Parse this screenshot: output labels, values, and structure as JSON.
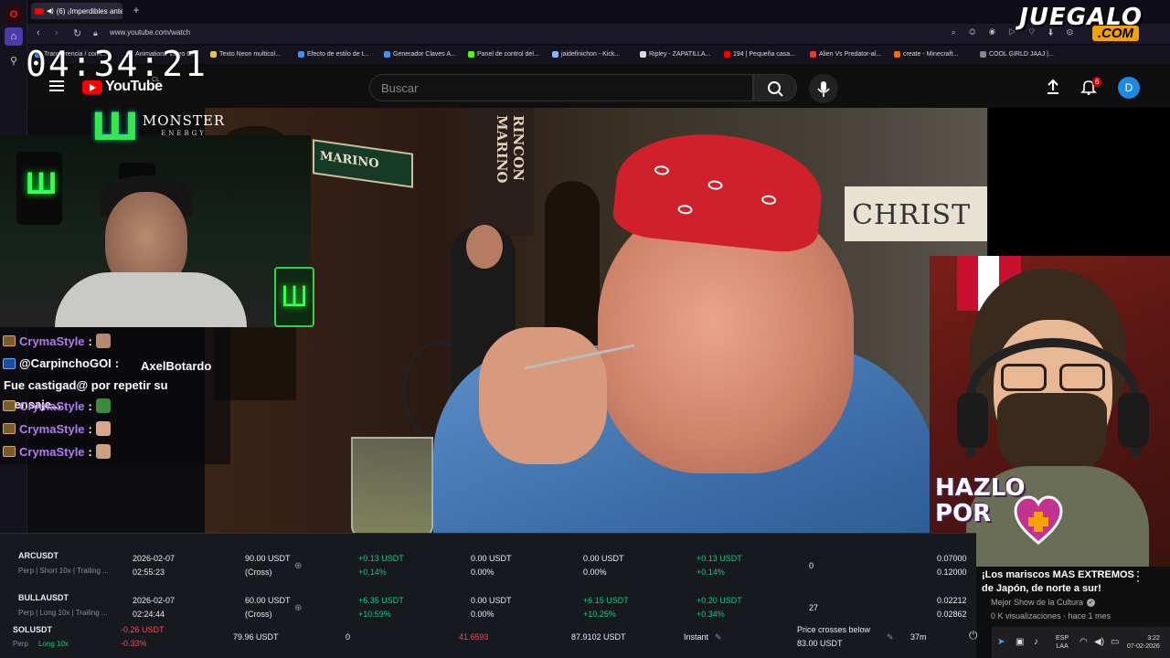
{
  "browser": {
    "tab_title": "(6) ¡Imperdibles ante",
    "url": "www.youtube.com/watch",
    "bookmarks": [
      "Transferencia / comi...",
      "Animations Video C...",
      "Texto Neon multicol...",
      "Efecto de estilo de t...",
      "Generador Claves A...",
      "Panel de control del...",
      "jaidefinichon - Kick...",
      "Ripley - ZAPATILLA...",
      "194 | Pequeña casa...",
      "Alien Vs Predator-al...",
      "create - Minecraft...",
      "COOL GIRLD JAAJ |..."
    ]
  },
  "overlay": {
    "timer": "04:34:21",
    "brand_logo": "JUEGALO",
    "brand_logo_suffix": ".COM",
    "monster_text": "MONSTER",
    "monster_sub": "ENERGY",
    "hazlo_line1": "HAZLO",
    "hazlo_line2": "POR"
  },
  "youtube": {
    "logo_text": "YouTube",
    "region": "CL",
    "search_placeholder": "Buscar",
    "notification_count": "6",
    "avatar_letter": "D",
    "video": {
      "sign_marino": "MARINO",
      "sign_rincon": "RINCON MARINO",
      "sign_christ": "CHRIST",
      "title": "¡Los mariscos MAS EXTREMOS de Japón, de norte a sur!",
      "channel": "Mejor Show de la Cultura",
      "stats": "0 K visualizaciones · hace 1 mes"
    }
  },
  "chat": {
    "messages": [
      {
        "user": "CrymaStyle",
        "text": ""
      },
      {
        "user": "@CarpinchoGOI",
        "text": "AxelBotardo Fue castigad@ por repetir su mensaje..."
      },
      {
        "user": "CrymaStyle",
        "text": ""
      },
      {
        "user": "CrymaStyle",
        "text": ""
      },
      {
        "user": "CrymaStyle",
        "text": ""
      }
    ]
  },
  "trading": {
    "rows": [
      {
        "symbol": "ARCUSDT",
        "sub": "Perp | Short 10x | Trailing ...",
        "date": "2026-02-07",
        "time": "02:55:23",
        "margin": "90.00 USDT",
        "margin_mode": "(Cross)",
        "pnl_a": "+0.13 USDT",
        "pnl_a_pct": "+0.14%",
        "b": "0.00 USDT",
        "b_pct": "0.00%",
        "c": "0.00 USDT",
        "c_pct": "0.00%",
        "d": "+0.13 USDT",
        "d_pct": "+0.14%",
        "count": "0",
        "price1": "0.07000",
        "price2": "0.12000"
      },
      {
        "symbol": "BULLAUSDT",
        "sub": "Perp | Long 10x | Trailing ...",
        "date": "2026-02-07",
        "time": "02:24:44",
        "margin": "60.00 USDT",
        "margin_mode": "(Cross)",
        "pnl_a": "+6.35 USDT",
        "pnl_a_pct": "+10.59%",
        "b": "0.00 USDT",
        "b_pct": "0.00%",
        "c": "+6.15 USDT",
        "c_pct": "+10.25%",
        "d": "+0.20 USDT",
        "d_pct": "+0.34%",
        "count": "27",
        "price1": "0.02212",
        "price2": "0.02862"
      }
    ],
    "bottom": {
      "symbol": "SOLUSDT",
      "sub_perp": "Perp",
      "sub_long": "Long 10x",
      "pnl": "-0.26 USDT",
      "pnl_pct": "-0.33%",
      "value": "79.96 USDT",
      "zero": "0",
      "price": "41.6593",
      "price2": "87.9102 USDT",
      "instant": "Instant",
      "trigger": "Price crosses below",
      "trigger_value": "83.00 USDT",
      "duration": "37m"
    }
  },
  "taskbar": {
    "lang1": "ESP",
    "lang2": "LAA",
    "time": "3:22",
    "date": "07-02-2026"
  },
  "colors": {
    "youtube_red": "#ff0000",
    "profit_green": "#0ecb81",
    "loss_red": "#f6465d",
    "chat_user_purple": "#b07cf0",
    "brand_orange": "#f5a100"
  }
}
